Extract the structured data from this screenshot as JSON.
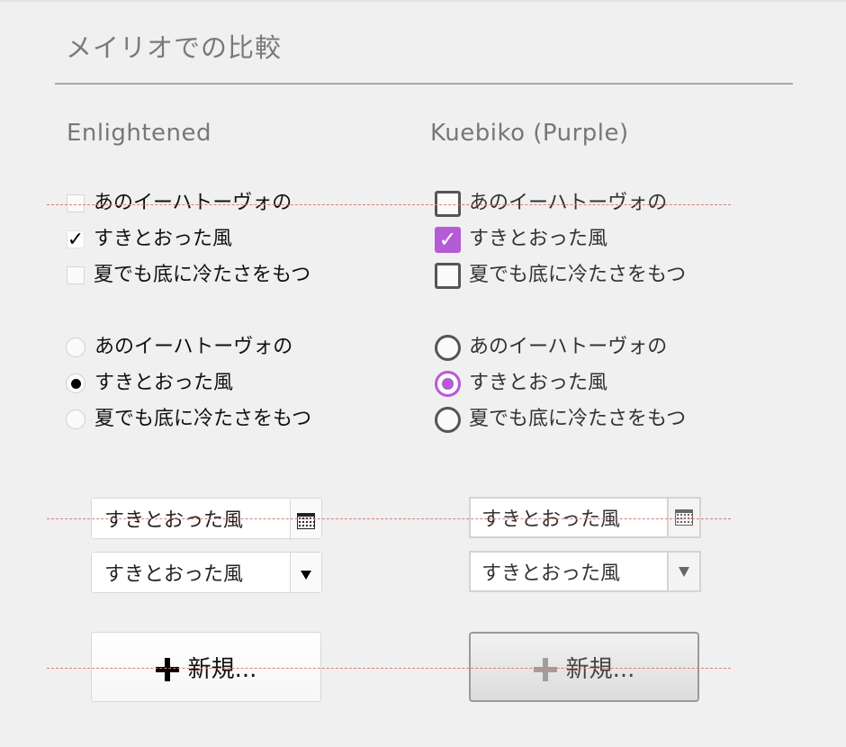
{
  "page": {
    "title": "メイリオでの比較"
  },
  "columns": {
    "left": {
      "heading": "Enlightened"
    },
    "right": {
      "heading": "Kuebiko (Purple)"
    }
  },
  "checkboxes": [
    {
      "label": "あのイーハトーヴォの",
      "checked": false
    },
    {
      "label": "すきとおった風",
      "checked": true
    },
    {
      "label": "夏でも底に冷たさをもつ",
      "checked": false
    }
  ],
  "radios": [
    {
      "label": "あのイーハトーヴォの",
      "selected": false
    },
    {
      "label": "すきとおった風",
      "selected": true
    },
    {
      "label": "夏でも底に冷たさをもつ",
      "selected": false
    }
  ],
  "date_field": {
    "value": "すきとおった風",
    "icon": "calendar-icon"
  },
  "dropdown": {
    "value": "すきとおった風",
    "icon": "chevron-down-icon"
  },
  "new_button": {
    "label": "新規...",
    "icon": "plus-icon"
  },
  "colors": {
    "background": "#f0f0f0",
    "kuebiko_accent": "#b55bd6",
    "guide_line": "#e07a7a"
  }
}
